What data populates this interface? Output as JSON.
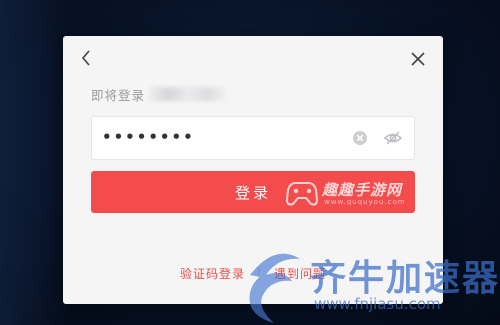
{
  "dialog": {
    "back_icon": "chevron-left-icon",
    "close_icon": "close-icon",
    "prompt_label": "即将登录",
    "password": {
      "masked_value": "••••••••",
      "clear_icon": "clear-circle-icon",
      "visibility_icon": "eye-off-icon"
    },
    "login_button_label": "登录",
    "footer": {
      "sms_login_label": "验证码登录",
      "separator": "|",
      "problem_label": "遇到问题"
    }
  },
  "watermarks": {
    "quqio_text": "趣趣手游网",
    "quqio_url": "www.ququyou.com",
    "jisu_name": "齐牛加速器",
    "jisu_url": "www.fnjiasu.com"
  },
  "colors": {
    "accent": "#f44b4d",
    "link": "#e8504c",
    "dialog_bg": "#f5f5f6",
    "backdrop": "#071226"
  }
}
